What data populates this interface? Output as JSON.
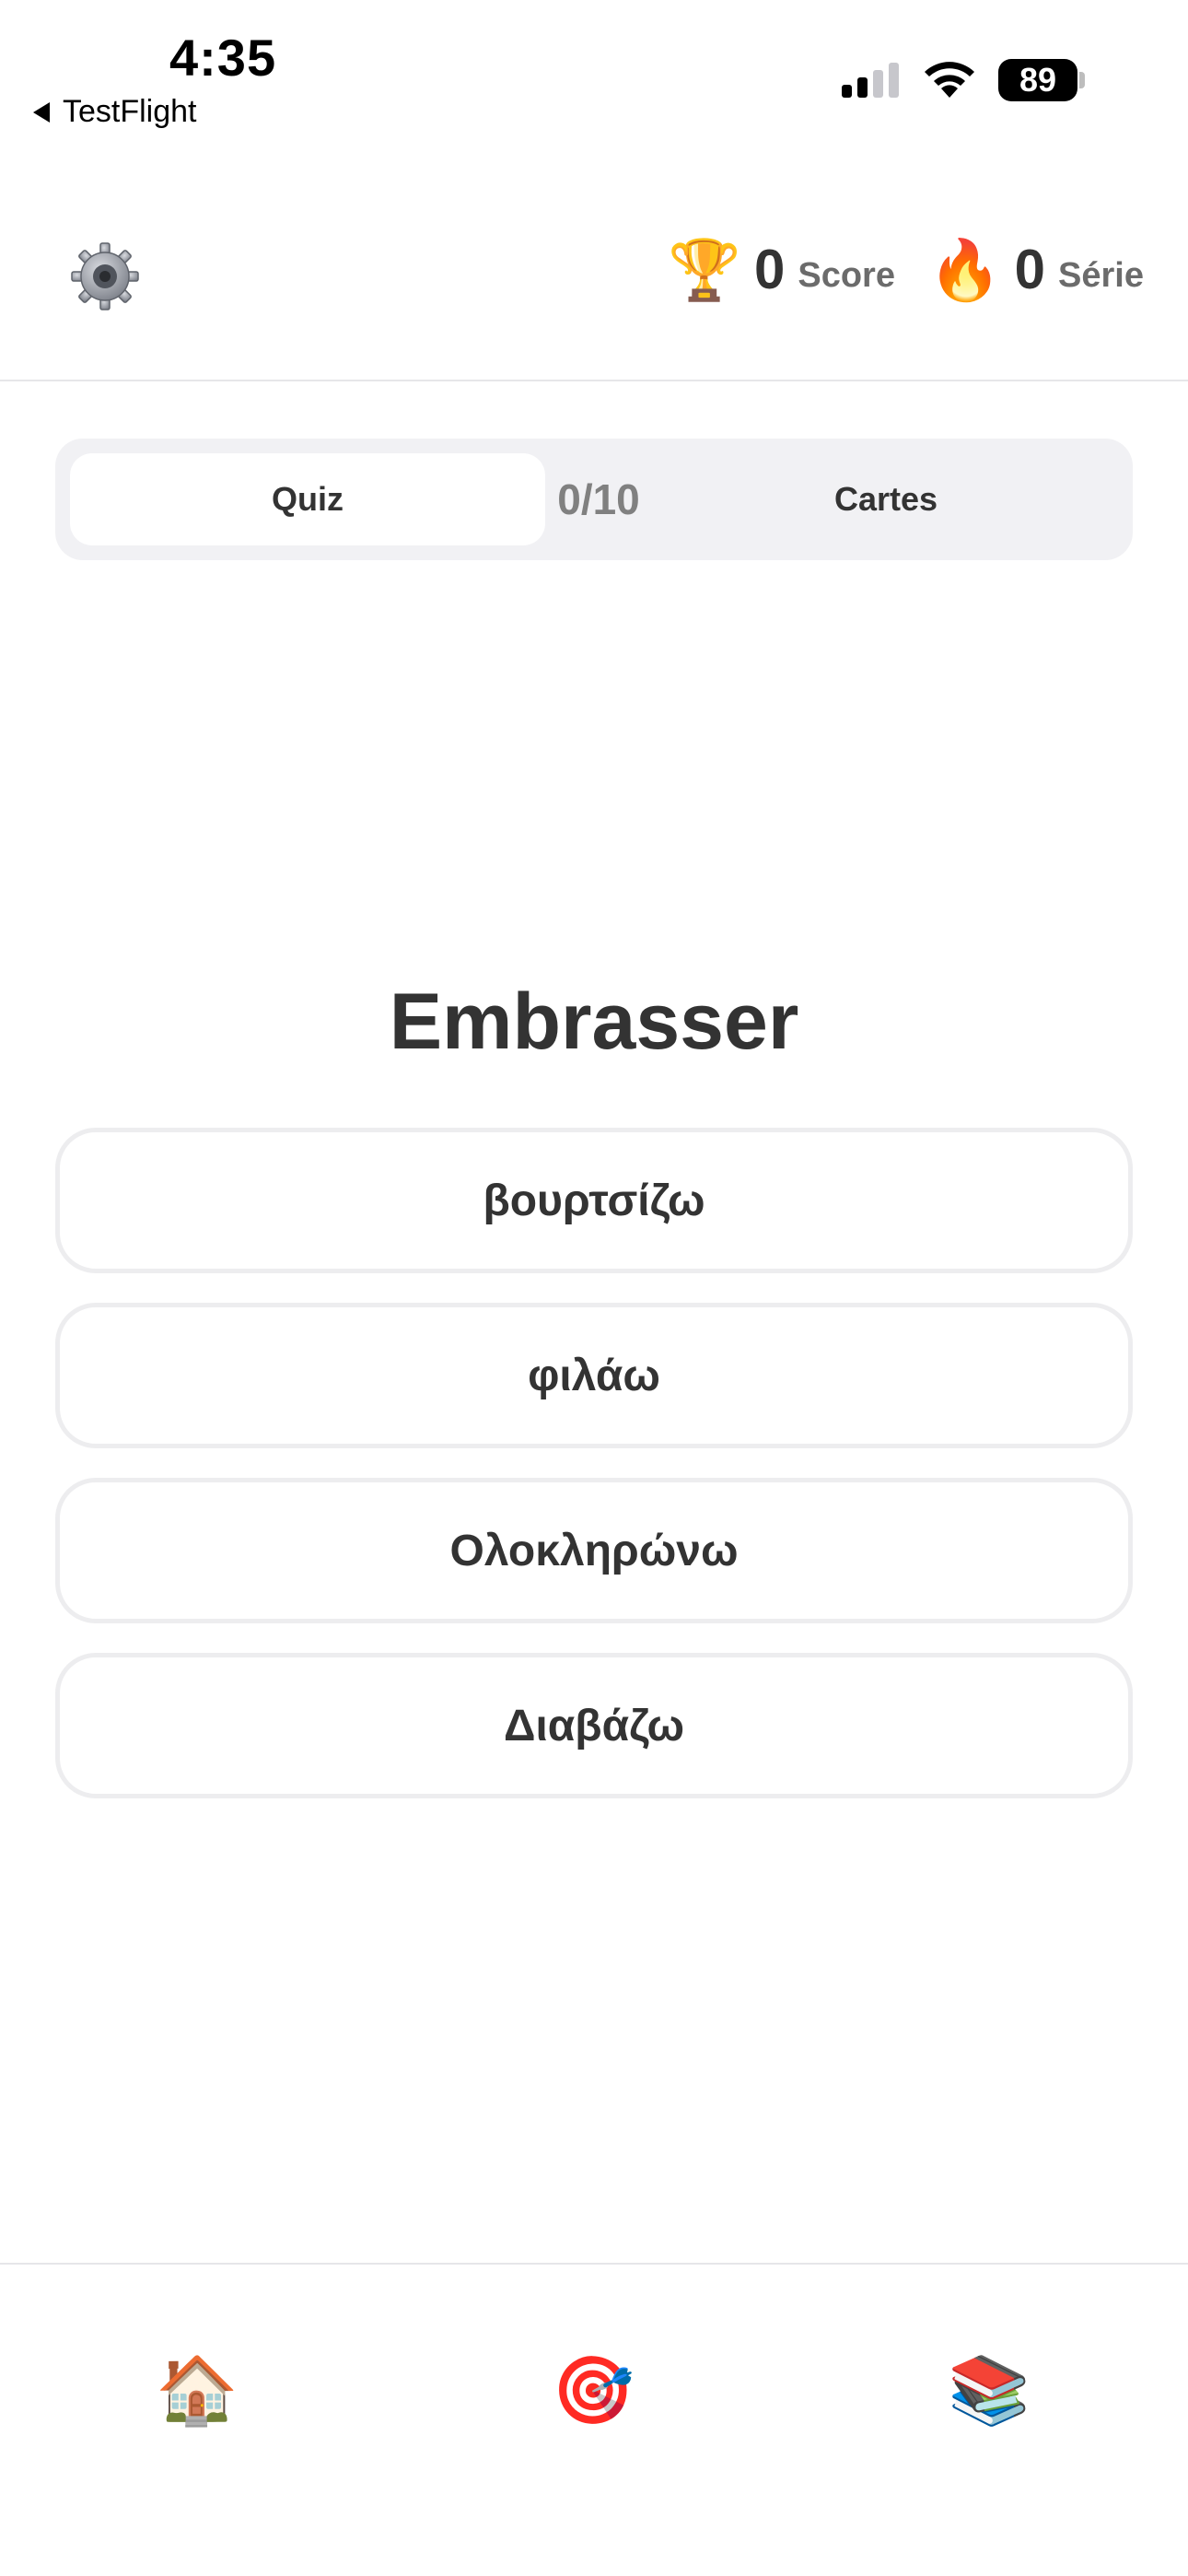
{
  "status_bar": {
    "time": "4:35",
    "back_label": "TestFlight",
    "battery": "89"
  },
  "header": {
    "score": {
      "icon": "trophy-icon",
      "emoji": "🏆",
      "value": "0",
      "label": "Score"
    },
    "streak": {
      "icon": "fire-icon",
      "emoji": "🔥",
      "value": "0",
      "label": "Série"
    }
  },
  "mode_switch": {
    "quiz_label": "Quiz",
    "progress": "0/10",
    "cards_label": "Cartes",
    "selected": "Quiz"
  },
  "quiz": {
    "question": "Embrasser",
    "answers": [
      "βουρτσίζω",
      "φιλάω",
      "Ολοκληρώνω",
      "Διαβάζω"
    ]
  },
  "tab_bar": {
    "home": {
      "icon": "house-icon",
      "emoji": "🏠"
    },
    "quiz": {
      "icon": "target-icon",
      "emoji": "🎯"
    },
    "library": {
      "icon": "books-icon",
      "emoji": "📚"
    }
  },
  "colors": {
    "text": "#333333",
    "muted": "#6b6b6b",
    "segment_bg": "#f1f1f4",
    "answer_border": "#ededef"
  }
}
